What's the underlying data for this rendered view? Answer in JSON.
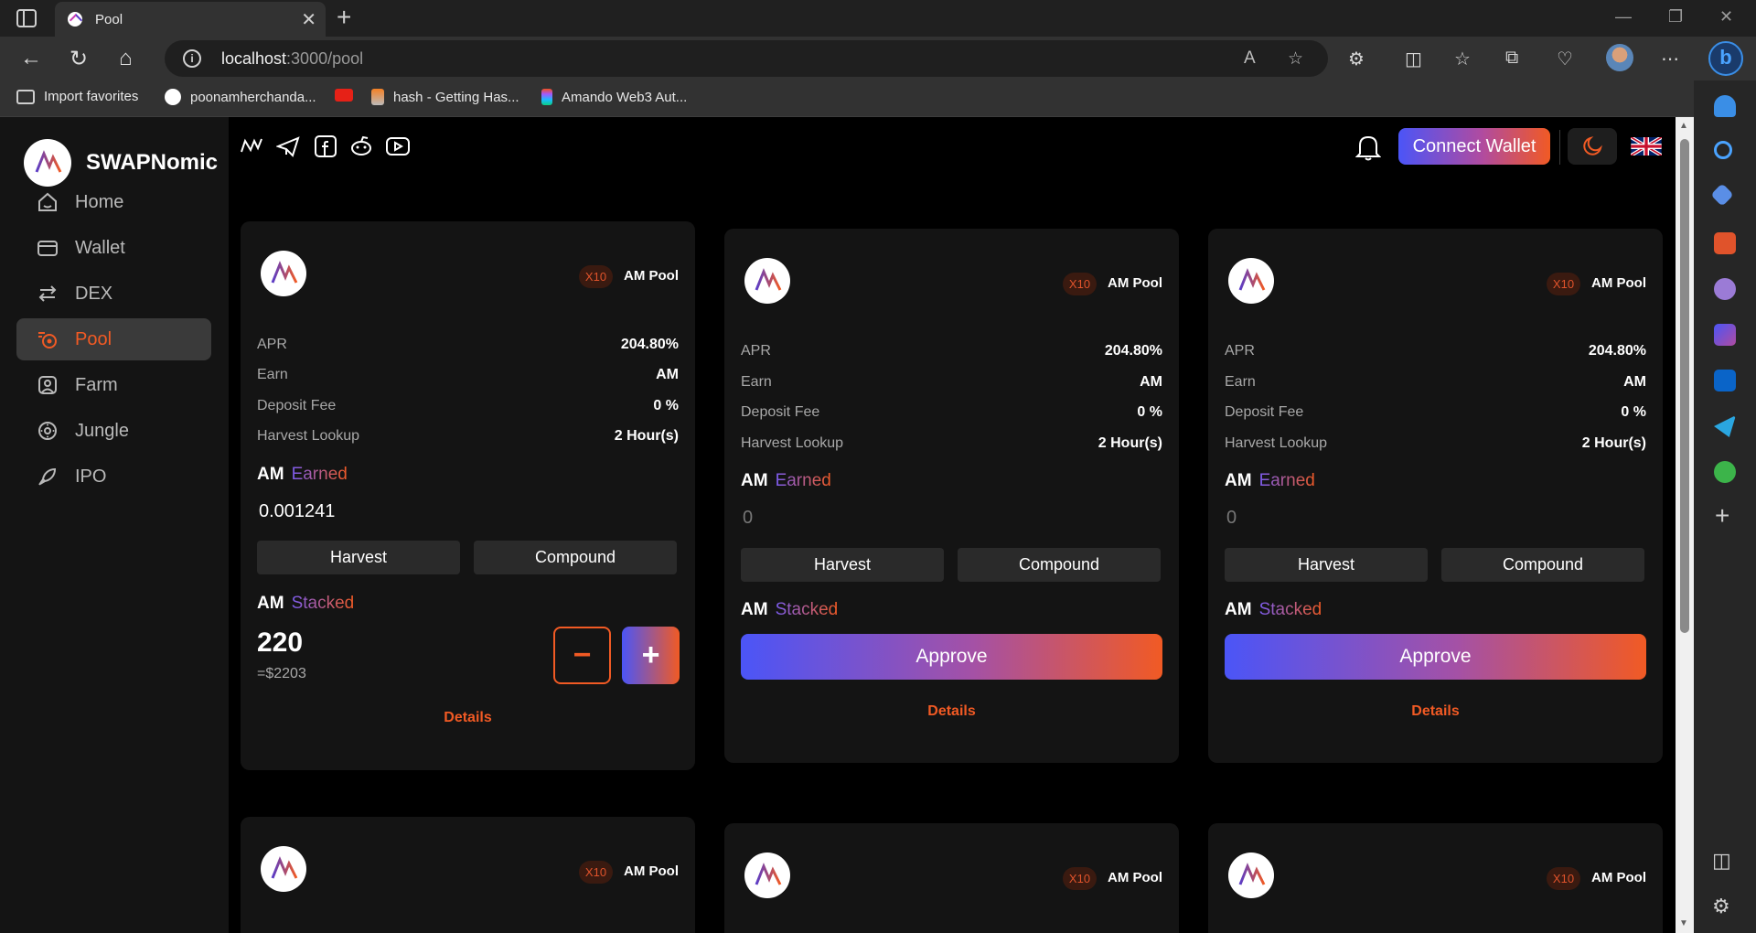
{
  "browser": {
    "tab_title": "Pool",
    "url_host": "localhost",
    "url_path": ":3000/pool",
    "favorites": [
      {
        "label": "Import favorites"
      },
      {
        "label": "poonamherchanda..."
      },
      {
        "label": "hash - Getting Has..."
      },
      {
        "label": "Amando Web3 Aut..."
      }
    ]
  },
  "app": {
    "brand": "SWAPNomic",
    "nav": [
      {
        "label": "Home",
        "icon": "home-icon"
      },
      {
        "label": "Wallet",
        "icon": "wallet-icon"
      },
      {
        "label": "DEX",
        "icon": "swap-arrows-icon"
      },
      {
        "label": "Pool",
        "icon": "pool-icon",
        "active": true
      },
      {
        "label": "Farm",
        "icon": "farm-icon"
      },
      {
        "label": "Jungle",
        "icon": "jungle-icon"
      },
      {
        "label": "IPO",
        "icon": "rocket-icon"
      }
    ],
    "connect_wallet": "Connect Wallet",
    "accent": "#f15a24"
  },
  "pools": [
    {
      "badge": "X10",
      "name": "AM Pool",
      "apr_label": "APR",
      "apr": "204.80%",
      "earn_label": "Earn",
      "earn": "AM",
      "fee_label": "Deposit Fee",
      "fee": "0 %",
      "harvest_label": "Harvest Lookup",
      "harvest": "2 Hour(s)",
      "earned_token": "AM",
      "earned_word": "Earned",
      "earned_value": "0.001241",
      "harvest_btn": "Harvest",
      "compound_btn": "Compound",
      "stacked_token": "AM",
      "stacked_word": "Stacked",
      "stacked_value": "220",
      "stacked_usd": "=$2203",
      "minus": "−",
      "plus": "+",
      "details": "Details"
    },
    {
      "badge": "X10",
      "name": "AM Pool",
      "apr_label": "APR",
      "apr": "204.80%",
      "earn_label": "Earn",
      "earn": "AM",
      "fee_label": "Deposit Fee",
      "fee": "0 %",
      "harvest_label": "Harvest Lookup",
      "harvest": "2 Hour(s)",
      "earned_token": "AM",
      "earned_word": "Earned",
      "earned_value": "0",
      "harvest_btn": "Harvest",
      "compound_btn": "Compound",
      "stacked_token": "AM",
      "stacked_word": "Stacked",
      "approve": "Approve",
      "details": "Details"
    },
    {
      "badge": "X10",
      "name": "AM Pool",
      "apr_label": "APR",
      "apr": "204.80%",
      "earn_label": "Earn",
      "earn": "AM",
      "fee_label": "Deposit Fee",
      "fee": "0 %",
      "harvest_label": "Harvest Lookup",
      "harvest": "2 Hour(s)",
      "earned_token": "AM",
      "earned_word": "Earned",
      "earned_value": "0",
      "harvest_btn": "Harvest",
      "compound_btn": "Compound",
      "stacked_token": "AM",
      "stacked_word": "Stacked",
      "approve": "Approve",
      "details": "Details"
    },
    {
      "badge": "X10",
      "name": "AM Pool"
    },
    {
      "badge": "X10",
      "name": "AM Pool"
    },
    {
      "badge": "X10",
      "name": "AM Pool"
    }
  ]
}
